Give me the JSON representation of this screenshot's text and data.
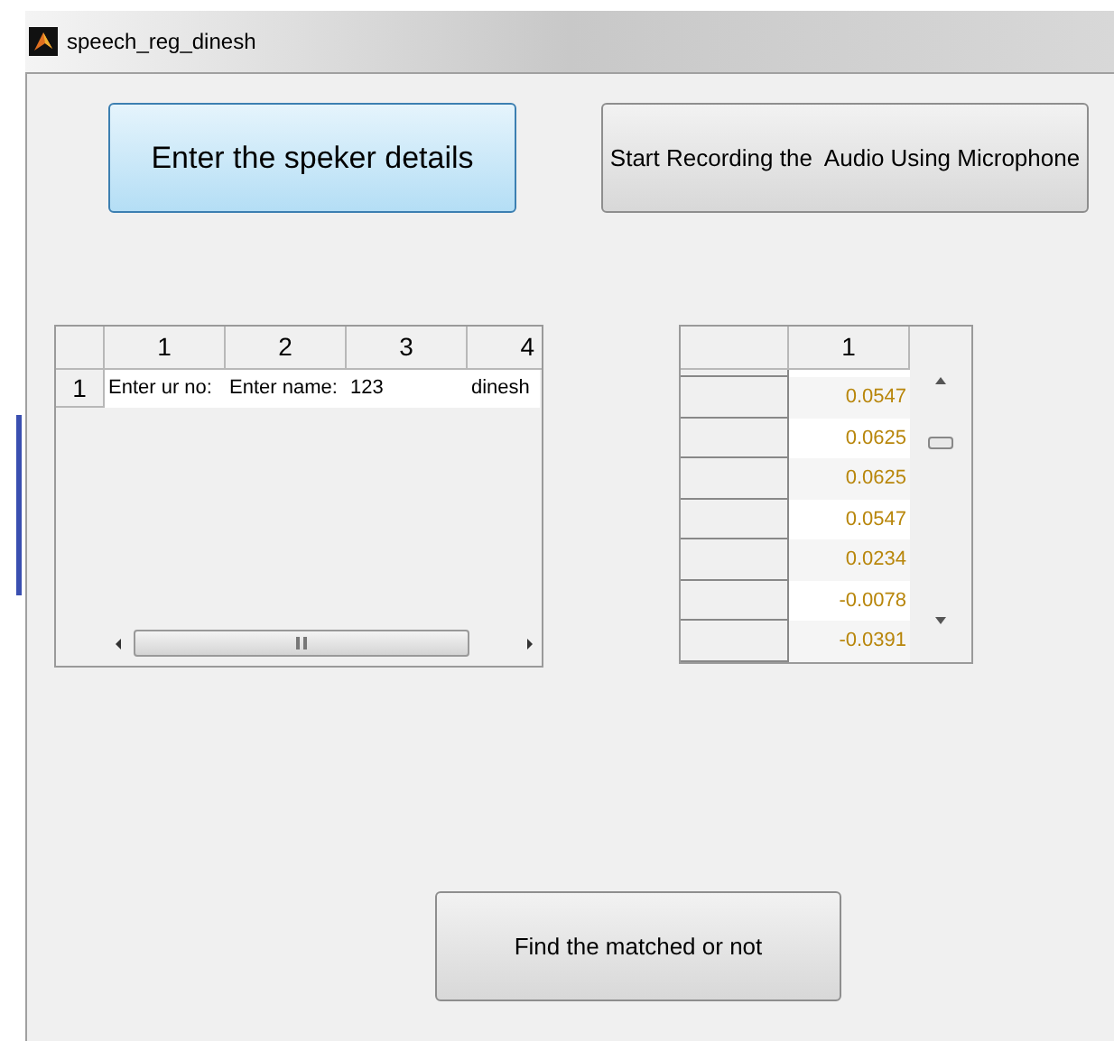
{
  "window": {
    "title": "speech_reg_dinesh"
  },
  "buttons": [
    {
      "label": "Enter the speker details",
      "selected": true
    },
    {
      "label": "Start Recording the  Audio Using Microphone",
      "selected": false
    }
  ],
  "details_table": {
    "columns": [
      "1",
      "2",
      "3",
      "4"
    ],
    "rows": [
      {
        "header": "1",
        "cells": [
          "Enter ur no:",
          "Enter name:",
          "123",
          "dinesh"
        ]
      }
    ]
  },
  "samples_table": {
    "columns": [
      "1"
    ],
    "values": [
      "0.0547",
      "0.0625",
      "0.0625",
      "0.0547",
      "0.0234",
      "-0.0078",
      "-0.0391"
    ]
  },
  "find_button": {
    "label": "Find the matched or not"
  }
}
